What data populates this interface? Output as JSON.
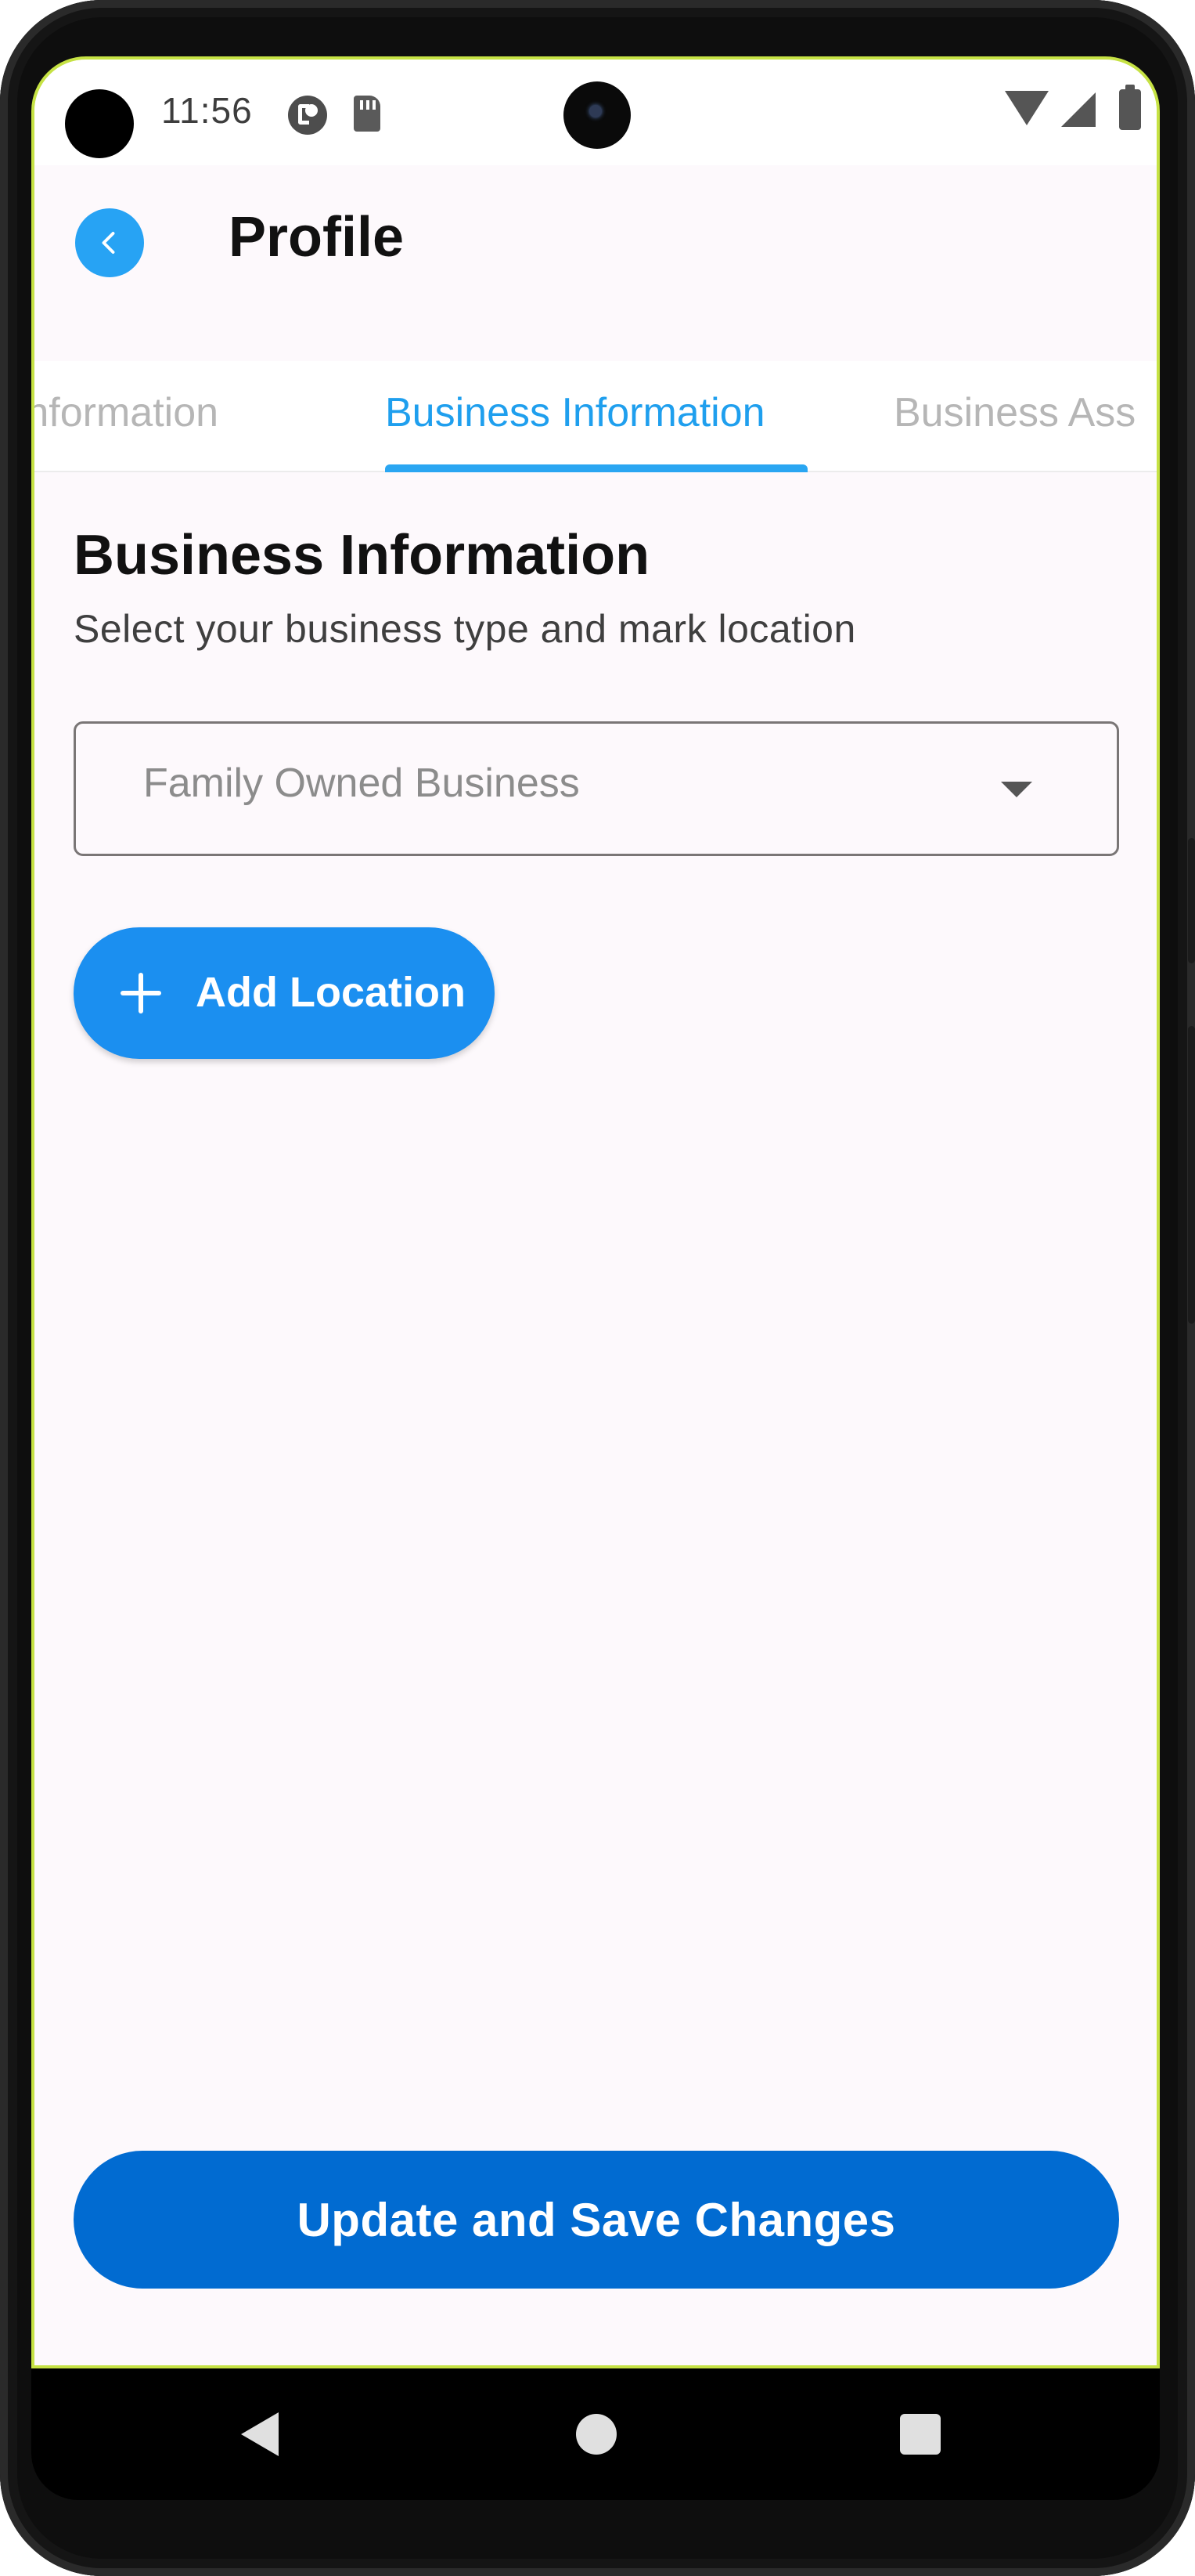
{
  "status_bar": {
    "time": "11:56",
    "icons": [
      "punch-hole",
      "p-notification-icon",
      "sd-card-icon",
      "wifi-icon",
      "cellular-signal-icon",
      "battery-icon"
    ]
  },
  "app_bar": {
    "back_icon": "chevron-left-icon",
    "title": "Profile"
  },
  "tabs": [
    {
      "label": "Personal Information"
    },
    {
      "label": "Business Information",
      "active": true
    },
    {
      "label": "Business Assets"
    }
  ],
  "tab_visible_text": {
    "personal": "al Information",
    "business": "Business Information",
    "assets": "Business Ass"
  },
  "section": {
    "title": "Business Information",
    "subtitle": "Select your business type and mark location"
  },
  "business_type_dropdown": {
    "value": "Family Owned Business",
    "icon": "dropdown-arrow-icon"
  },
  "add_location_button": {
    "label": "Add Location",
    "icon": "plus-icon"
  },
  "save_button": {
    "label": "Update and Save Changes"
  },
  "colors": {
    "accent": "#27a3f4",
    "primary_button": "#016bd1",
    "add_button": "#1b8ff0",
    "active_tab": "#1f9fee",
    "inactive_tab": "#b6b6b6",
    "background": "#fdf9fc"
  },
  "nav_bar": {
    "icons": [
      "nav-back-icon",
      "nav-home-icon",
      "nav-recents-icon"
    ]
  }
}
